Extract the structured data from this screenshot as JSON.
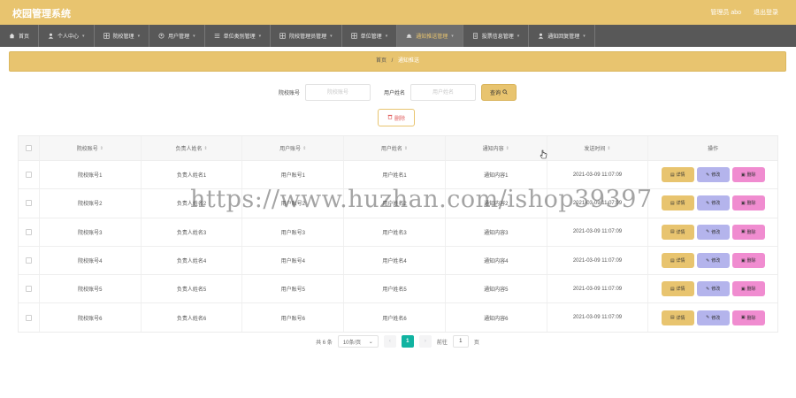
{
  "header": {
    "app_title": "校园管理系统",
    "admin_label": "管理员 abo",
    "logout_label": "退出登录"
  },
  "nav": {
    "items": [
      {
        "label": "首页",
        "icon": "home-icon",
        "has_caret": false
      },
      {
        "label": "个人中心",
        "icon": "user-icon",
        "has_caret": true
      },
      {
        "label": "院校管理",
        "icon": "grid-icon",
        "has_caret": true
      },
      {
        "label": "用户管理",
        "icon": "users-icon",
        "has_caret": true
      },
      {
        "label": "单位类别管理",
        "icon": "list-icon",
        "has_caret": true
      },
      {
        "label": "院校管理员管理",
        "icon": "grid-icon",
        "has_caret": true
      },
      {
        "label": "单位管理",
        "icon": "grid-icon",
        "has_caret": true
      },
      {
        "label": "通知推送管理",
        "icon": "bell-icon",
        "has_caret": true,
        "active": true
      },
      {
        "label": "投票信息管理",
        "icon": "doc-icon",
        "has_caret": true
      },
      {
        "label": "通知回复管理",
        "icon": "user-icon",
        "has_caret": true
      }
    ]
  },
  "breadcrumb": {
    "home": "首页",
    "separator": "/",
    "current": "通知推送"
  },
  "search": {
    "field1_label": "院校账号",
    "field1_placeholder": "院校账号",
    "field2_label": "用户姓名",
    "field2_placeholder": "用户姓名",
    "query_label": "查询"
  },
  "batch_delete_label": "删除",
  "table": {
    "columns": [
      "院校账号",
      "负责人姓名",
      "用户账号",
      "用户姓名",
      "通知内容",
      "发送时间",
      "操作"
    ],
    "rows": [
      [
        "院校账号1",
        "负责人姓名1",
        "用户账号1",
        "用户姓名1",
        "通知内容1",
        "2021-03-09 11:07:09"
      ],
      [
        "院校账号2",
        "负责人姓名2",
        "用户账号2",
        "用户姓名2",
        "通知内容2",
        "2021-03-09 11:07:09"
      ],
      [
        "院校账号3",
        "负责人姓名3",
        "用户账号3",
        "用户姓名3",
        "通知内容3",
        "2021-03-09 11:07:09"
      ],
      [
        "院校账号4",
        "负责人姓名4",
        "用户账号4",
        "用户姓名4",
        "通知内容4",
        "2021-03-09 11:07:09"
      ],
      [
        "院校账号5",
        "负责人姓名5",
        "用户账号5",
        "用户姓名5",
        "通知内容5",
        "2021-03-09 11:07:09"
      ],
      [
        "院校账号6",
        "负责人姓名6",
        "用户账号6",
        "用户姓名6",
        "通知内容6",
        "2021-03-09 11:07:09"
      ]
    ],
    "actions": {
      "detail": "详情",
      "edit": "修改",
      "delete": "删除"
    }
  },
  "pagination": {
    "total_text": "共 6 条",
    "page_size": "10条/页",
    "current_page": "1",
    "goto_label": "前往",
    "goto_value": "1",
    "page_suffix": "页"
  },
  "watermark": "https://www.huzhan.com/ishop39397",
  "colors": {
    "header": "#e8c46f",
    "nav_bg": "#585858",
    "detail_btn": "#e8c46f",
    "edit_btn": "#b4b4ec",
    "delete_btn": "#f08cd0",
    "page_active": "#11b3a1"
  }
}
